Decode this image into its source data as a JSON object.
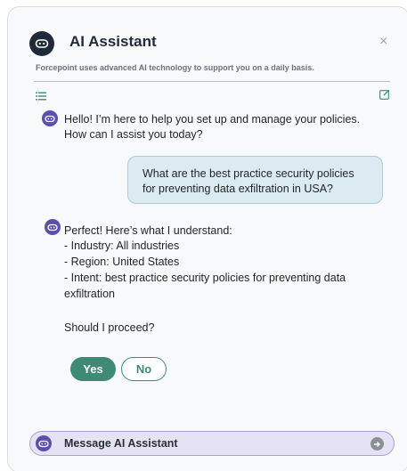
{
  "header": {
    "title": "AI Assistant",
    "subtitle": "Forcepoint uses advanced AI technology to support you on a daily basis.",
    "close_label": "×"
  },
  "icons": {
    "header": "bot-icon",
    "menu": "list-icon",
    "edit": "edit-icon",
    "send": "send-arrow-icon"
  },
  "messages": {
    "greeting_line1": "Hello! I’m here to help you set up and manage your policies.",
    "greeting_line2": "How can I assist you today?",
    "user_question": "What are the best practice security policies for preventing data exfiltration in USA?",
    "reply_intro": "Perfect! Here’s what I understand:",
    "reply_industry": "- Industry: All industries",
    "reply_region": "- Region: United States",
    "reply_intent_line1": "- Intent: best practice security policies for preventing data",
    "reply_intent_line2": "exfiltration",
    "reply_question": "Should I proceed?"
  },
  "actions": {
    "yes_label": "Yes",
    "no_label": "No"
  },
  "composer": {
    "placeholder": "Message AI Assistant"
  },
  "colors": {
    "bot_avatar": "#5b4fae",
    "accent_green": "#3e8a74",
    "user_bubble": "#dcebf1",
    "composer_bg": "#e5e2f4"
  }
}
